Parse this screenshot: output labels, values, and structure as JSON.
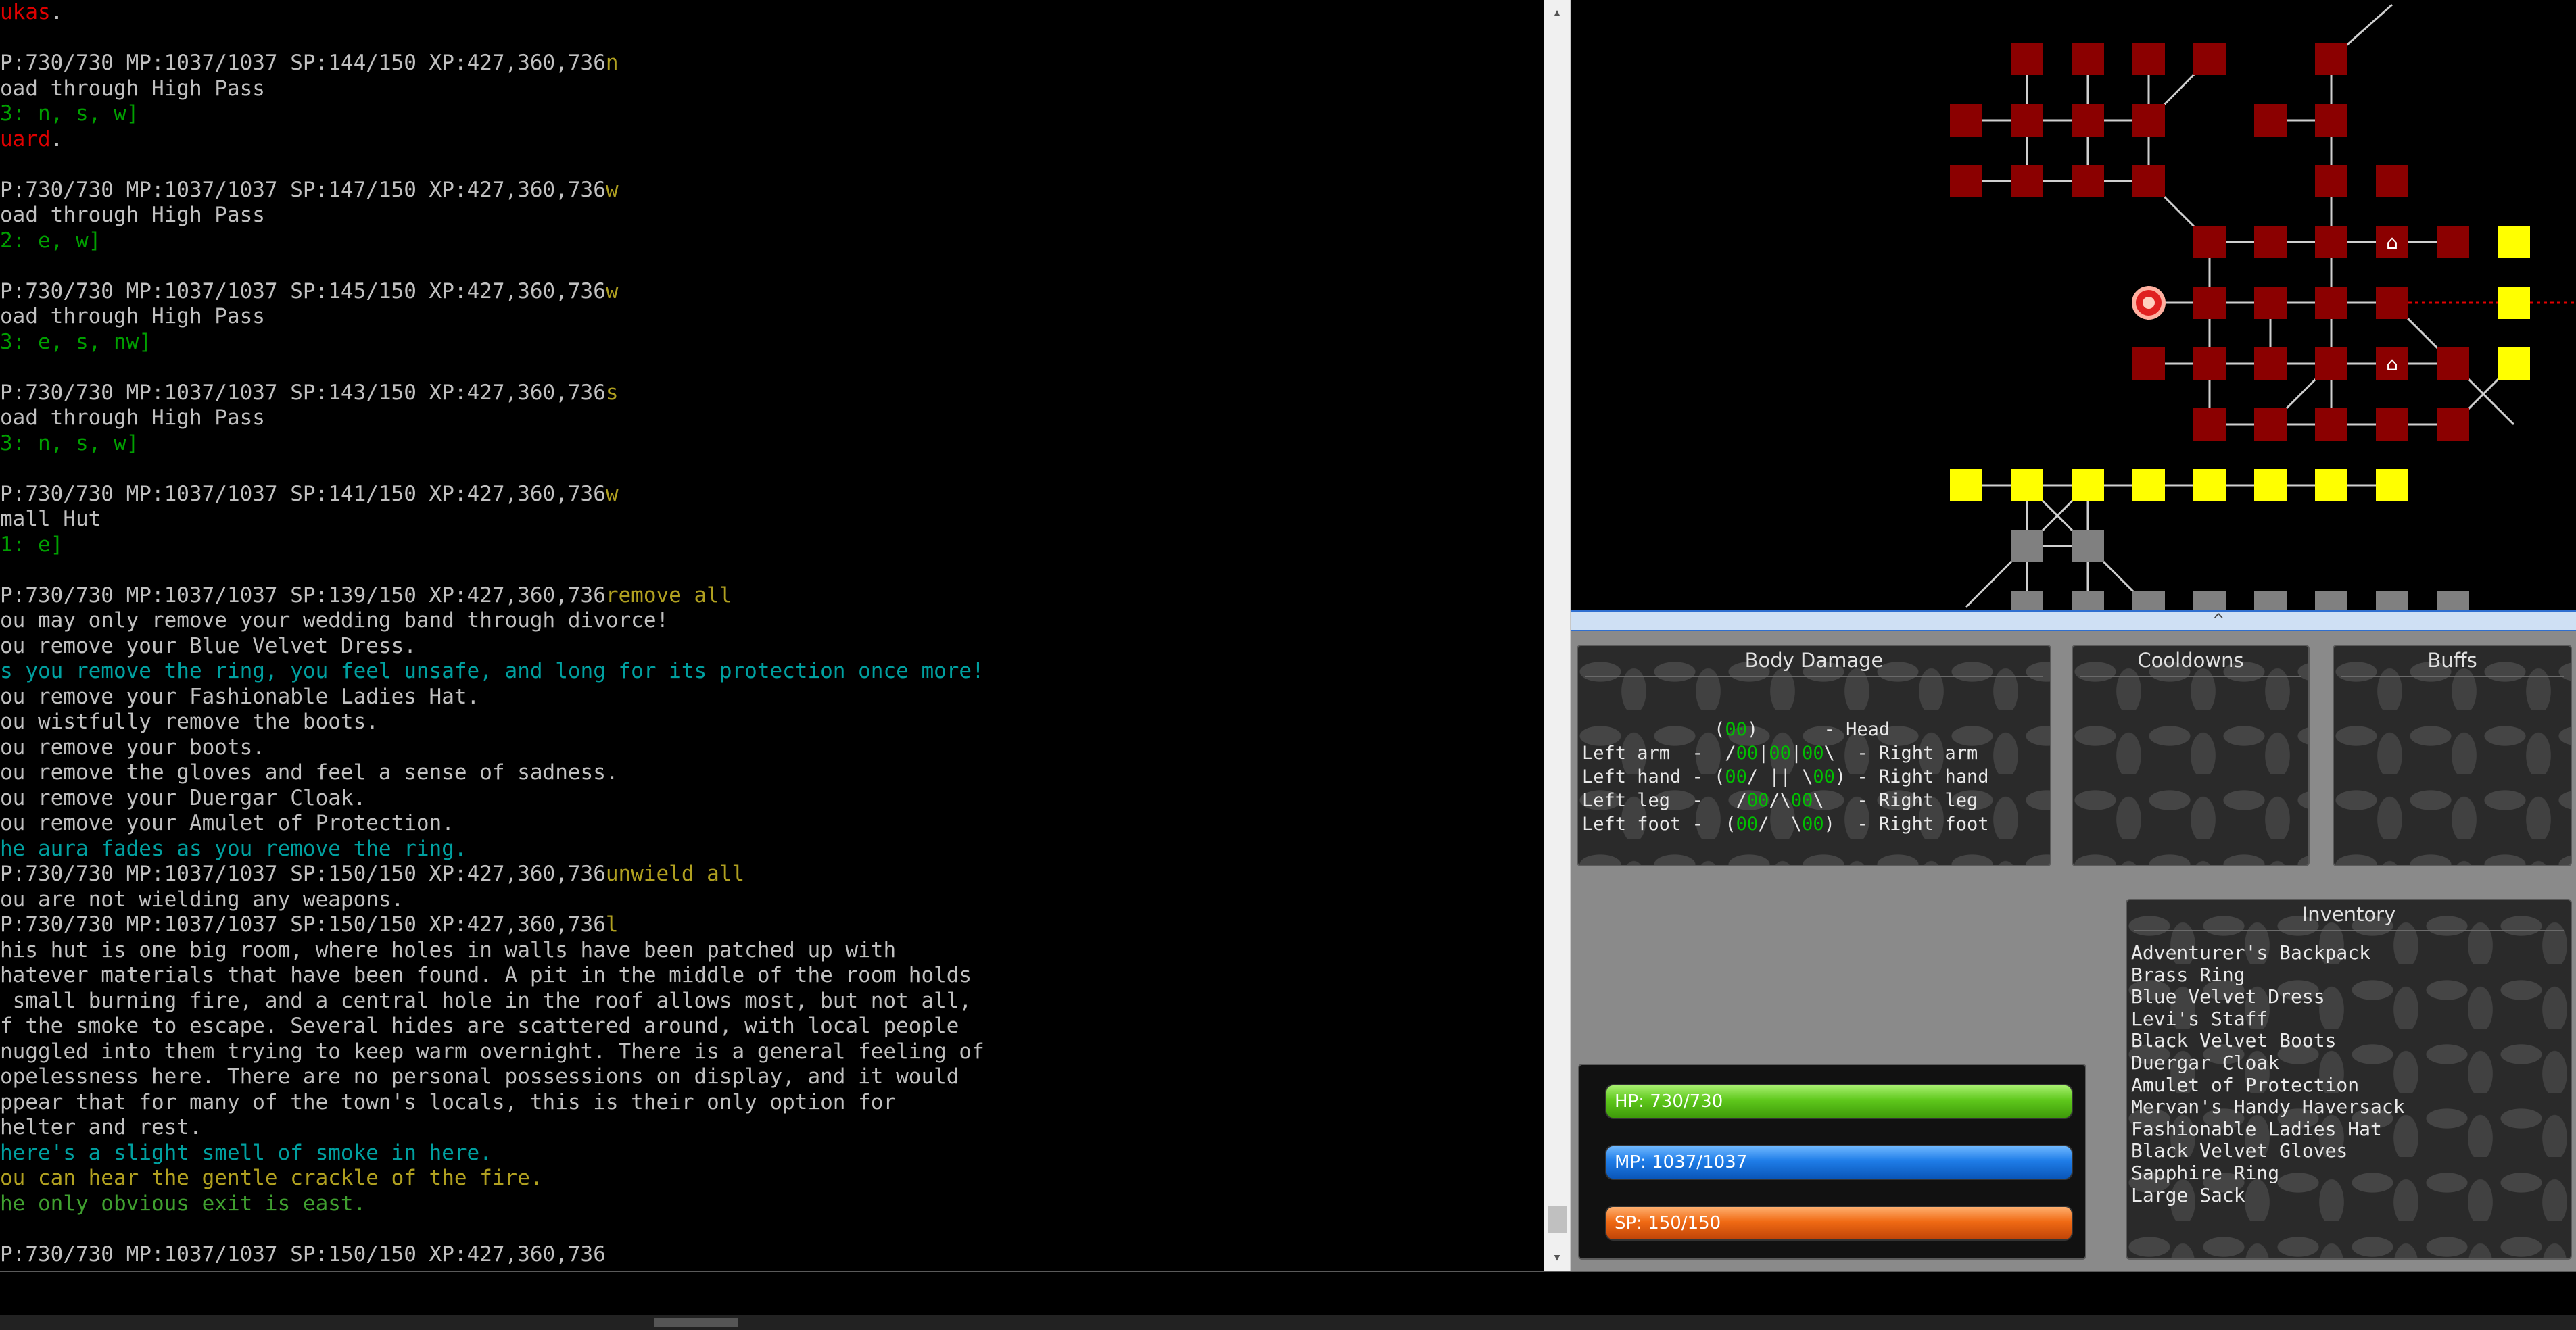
{
  "terminal": {
    "lines": [
      {
        "segments": [
          {
            "text": "ukas",
            "color": "red"
          },
          {
            "text": ".",
            "color": "gray"
          }
        ]
      },
      {
        "segments": []
      },
      {
        "segments": [
          {
            "text": "P:730/730 MP:1037/1037 SP:144/150 XP:427,360,736",
            "color": "gray"
          },
          {
            "text": "n",
            "color": "olive"
          }
        ]
      },
      {
        "segments": [
          {
            "text": "oad through High Pass",
            "color": "gray"
          }
        ]
      },
      {
        "segments": [
          {
            "text": "3: n, s, w]",
            "color": "green"
          }
        ]
      },
      {
        "segments": [
          {
            "text": "uard",
            "color": "red"
          },
          {
            "text": ".",
            "color": "gray"
          }
        ]
      },
      {
        "segments": []
      },
      {
        "segments": [
          {
            "text": "P:730/730 MP:1037/1037 SP:147/150 XP:427,360,736",
            "color": "gray"
          },
          {
            "text": "w",
            "color": "olive"
          }
        ]
      },
      {
        "segments": [
          {
            "text": "oad through High Pass",
            "color": "gray"
          }
        ]
      },
      {
        "segments": [
          {
            "text": "2: e, w]",
            "color": "green"
          }
        ]
      },
      {
        "segments": []
      },
      {
        "segments": [
          {
            "text": "P:730/730 MP:1037/1037 SP:145/150 XP:427,360,736",
            "color": "gray"
          },
          {
            "text": "w",
            "color": "olive"
          }
        ]
      },
      {
        "segments": [
          {
            "text": "oad through High Pass",
            "color": "gray"
          }
        ]
      },
      {
        "segments": [
          {
            "text": "3: e, s, nw]",
            "color": "green"
          }
        ]
      },
      {
        "segments": []
      },
      {
        "segments": [
          {
            "text": "P:730/730 MP:1037/1037 SP:143/150 XP:427,360,736",
            "color": "gray"
          },
          {
            "text": "s",
            "color": "olive"
          }
        ]
      },
      {
        "segments": [
          {
            "text": "oad through High Pass",
            "color": "gray"
          }
        ]
      },
      {
        "segments": [
          {
            "text": "3: n, s, w]",
            "color": "green"
          }
        ]
      },
      {
        "segments": []
      },
      {
        "segments": [
          {
            "text": "P:730/730 MP:1037/1037 SP:141/150 XP:427,360,736",
            "color": "gray"
          },
          {
            "text": "w",
            "color": "olive"
          }
        ]
      },
      {
        "segments": [
          {
            "text": "mall Hut",
            "color": "gray"
          }
        ]
      },
      {
        "segments": [
          {
            "text": "1: e]",
            "color": "green"
          }
        ]
      },
      {
        "segments": []
      },
      {
        "segments": [
          {
            "text": "P:730/730 MP:1037/1037 SP:139/150 XP:427,360,736",
            "color": "gray"
          },
          {
            "text": "remove all",
            "color": "olive"
          }
        ]
      },
      {
        "segments": [
          {
            "text": "ou may only remove your wedding band through divorce!",
            "color": "gray"
          }
        ]
      },
      {
        "segments": [
          {
            "text": "ou remove your Blue Velvet Dress.",
            "color": "gray"
          }
        ]
      },
      {
        "segments": [
          {
            "text": "s you remove the ring, you feel unsafe, and long for its protection once more!",
            "color": "teal"
          }
        ]
      },
      {
        "segments": [
          {
            "text": "ou remove your Fashionable Ladies Hat.",
            "color": "gray"
          }
        ]
      },
      {
        "segments": [
          {
            "text": "ou wistfully remove the boots.",
            "color": "gray"
          }
        ]
      },
      {
        "segments": [
          {
            "text": "ou remove your boots.",
            "color": "gray"
          }
        ]
      },
      {
        "segments": [
          {
            "text": "ou remove the gloves and feel a sense of sadness.",
            "color": "gray"
          }
        ]
      },
      {
        "segments": [
          {
            "text": "ou remove your Duergar Cloak.",
            "color": "gray"
          }
        ]
      },
      {
        "segments": [
          {
            "text": "ou remove your Amulet of Protection.",
            "color": "gray"
          }
        ]
      },
      {
        "segments": [
          {
            "text": "he aura fades as you remove the ring.",
            "color": "teal"
          }
        ]
      },
      {
        "segments": [
          {
            "text": "P:730/730 MP:1037/1037 SP:150/150 XP:427,360,736",
            "color": "gray"
          },
          {
            "text": "unwield all",
            "color": "olive"
          }
        ]
      },
      {
        "segments": [
          {
            "text": "ou are not wielding any weapons.",
            "color": "gray"
          }
        ]
      },
      {
        "segments": [
          {
            "text": "P:730/730 MP:1037/1037 SP:150/150 XP:427,360,736",
            "color": "gray"
          },
          {
            "text": "l",
            "color": "olive"
          }
        ]
      },
      {
        "segments": [
          {
            "text": "his hut is one big room, where holes in walls have been patched up with",
            "color": "gray"
          }
        ]
      },
      {
        "segments": [
          {
            "text": "hatever materials that have been found. A pit in the middle of the room holds",
            "color": "gray"
          }
        ]
      },
      {
        "segments": [
          {
            "text": " small burning fire, and a central hole in the roof allows most, but not all,",
            "color": "gray"
          }
        ]
      },
      {
        "segments": [
          {
            "text": "f the smoke to escape. Several hides are scattered around, with local people",
            "color": "gray"
          }
        ]
      },
      {
        "segments": [
          {
            "text": "nuggled into them trying to keep warm overnight. There is a general feeling of",
            "color": "gray"
          }
        ]
      },
      {
        "segments": [
          {
            "text": "opelessness here. There are no personal possessions on display, and it would",
            "color": "gray"
          }
        ]
      },
      {
        "segments": [
          {
            "text": "ppear that for many of the town's locals, this is their only option for",
            "color": "gray"
          }
        ]
      },
      {
        "segments": [
          {
            "text": "helter and rest.",
            "color": "gray"
          }
        ]
      },
      {
        "segments": [
          {
            "text": "here's a slight smell of smoke in here.",
            "color": "teal"
          }
        ]
      },
      {
        "segments": [
          {
            "text": "ou can hear the gentle crackle of the fire.",
            "color": "olive"
          }
        ]
      },
      {
        "segments": [
          {
            "text": "he only obvious exit is east.",
            "color": "dkgreen"
          }
        ]
      },
      {
        "segments": []
      },
      {
        "segments": [
          {
            "text": "P:730/730 MP:1037/1037 SP:150/150 XP:427,360,736",
            "color": "gray"
          }
        ]
      }
    ]
  },
  "colors": {
    "gray": "#c0c0c0",
    "red": "#e00000",
    "green": "#00a000",
    "olive": "#b0a020",
    "teal": "#00a0a0",
    "dkgreen": "#40a030",
    "room_red": "#8b0000",
    "room_yellow": "#ffff00",
    "room_gray": "#808080",
    "player": "#e02020"
  },
  "map": {
    "room_icons": [
      "shop-cart-icon",
      "player-location-icon"
    ]
  },
  "splitter": {
    "glyph": "^"
  },
  "body_damage": {
    "title": "Body Damage",
    "diagram": "            (00)      - Head\nLeft arm  -  /00|00|00\\  - Right arm\nLeft hand - (00/ || \\00) - Right hand\nLeft leg  -   /00/\\00\\   - Right leg\nLeft foot -  (00/  \\00)  - Right foot"
  },
  "cooldowns": {
    "title": "Cooldowns"
  },
  "buffs": {
    "title": "Buffs"
  },
  "inventory": {
    "title": "Inventory",
    "items": [
      "Adventurer's Backpack",
      "Brass Ring",
      "Blue Velvet Dress",
      "Levi's Staff",
      "Black Velvet Boots",
      "Duergar Cloak",
      "Amulet of Protection",
      "Mervan's Handy Haversack",
      "Fashionable Ladies Hat",
      "Black Velvet Gloves",
      "Sapphire Ring",
      "Large Sack"
    ]
  },
  "vitals": {
    "hp": {
      "label": "HP: 730/730",
      "fraction": 1.0
    },
    "mp": {
      "label": "MP: 1037/1037",
      "fraction": 1.0
    },
    "sp": {
      "label": "SP: 150/150",
      "fraction": 1.0
    }
  }
}
